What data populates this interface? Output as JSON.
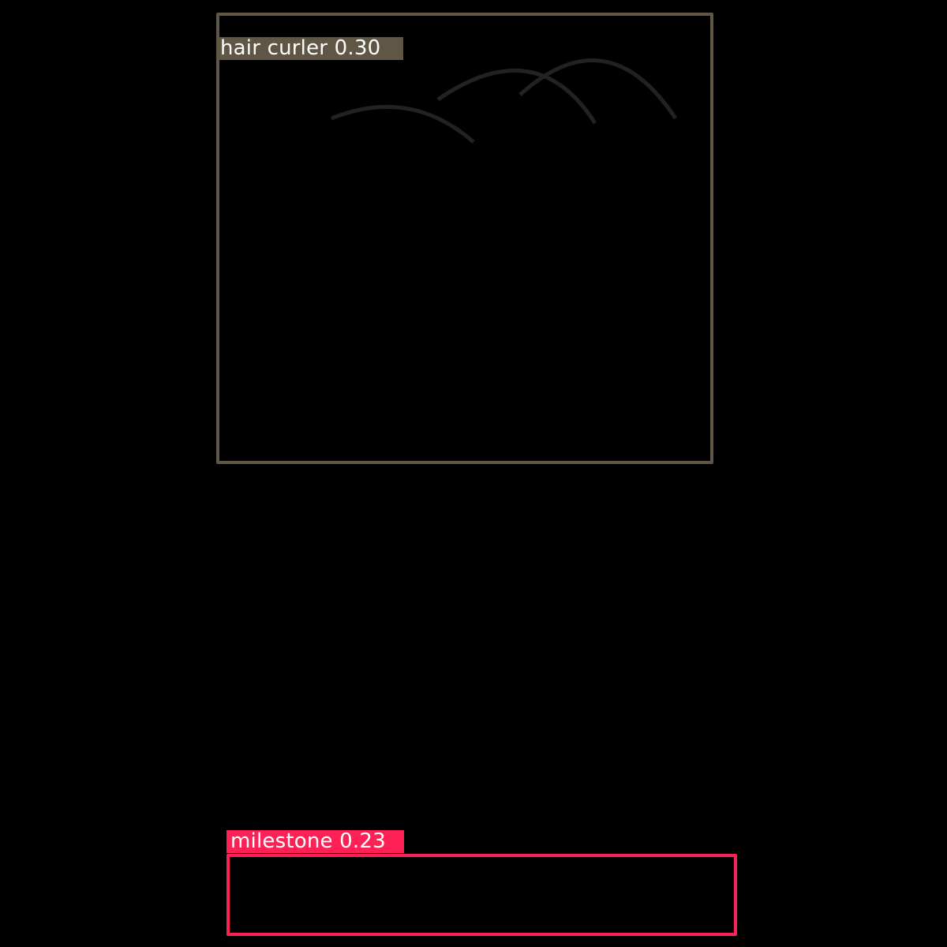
{
  "image": {
    "background_color": "#000000"
  },
  "detections": [
    {
      "label": "hair curler",
      "score": "0.30",
      "color": "#5f5646"
    },
    {
      "label": "milestone",
      "score": "0.23",
      "color": "#ff2156"
    }
  ],
  "strokes": {
    "color": "#222222"
  }
}
